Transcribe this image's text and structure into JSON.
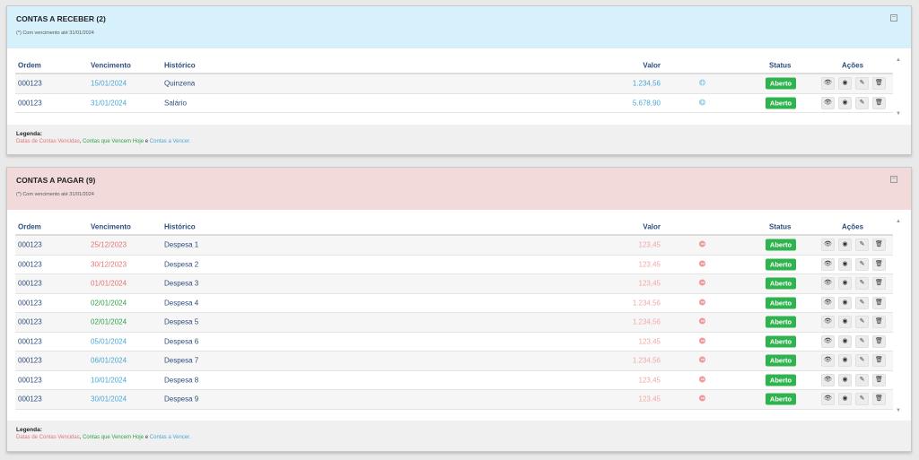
{
  "receber": {
    "title": "CONTAS A RECEBER (2)",
    "subtitle": "(*) Com vencimento até 31/01/2024",
    "collapse_icon": "minus-square-icon",
    "headers": {
      "ordem": "Ordem",
      "vencimento": "Vencimento",
      "historico": "Histórico",
      "valor": "Valor",
      "status": "Status",
      "acoes": "Ações"
    },
    "rows": [
      {
        "ordem": "000123",
        "vencimento": "15/01/2024",
        "historico": "Quinzena",
        "valor": "1.234,56",
        "status": "Aberto",
        "venc_color": "#4aa6d6",
        "valor_color": "#4aa6d6",
        "status_icon": "plus-circle-icon"
      },
      {
        "ordem": "000123",
        "vencimento": "31/01/2024",
        "historico": "Salário",
        "valor": "5.678,90",
        "status": "Aberto",
        "venc_color": "#4aa6d6",
        "valor_color": "#4aa6d6",
        "status_icon": "plus-circle-icon"
      }
    ],
    "legend": {
      "title": "Legenda:",
      "vencidas": "Datas de Contas Vencidas",
      "comma": ", ",
      "hoje": "Contas que Vencem Hoje",
      "e": " e ",
      "vencer": "Contas a Vencer",
      "dot": "."
    }
  },
  "pagar": {
    "title": "CONTAS A PAGAR (9)",
    "subtitle": "(*) Com vencimento até 31/01/2024",
    "collapse_icon": "minus-square-icon",
    "headers": {
      "ordem": "Ordem",
      "vencimento": "Vencimento",
      "historico": "Histórico",
      "valor": "Valor",
      "status": "Status",
      "acoes": "Ações"
    },
    "rows": [
      {
        "ordem": "000123",
        "vencimento": "25/12/2023",
        "historico": "Despesa 1",
        "valor": "123,45",
        "status": "Aberto",
        "venc_color": "#e57373",
        "valor_color": "#f0a8a8",
        "status_icon": "minus-circle-icon"
      },
      {
        "ordem": "000123",
        "vencimento": "30/12/2023",
        "historico": "Despesa 2",
        "valor": "123,45",
        "status": "Aberto",
        "venc_color": "#e57373",
        "valor_color": "#f0a8a8",
        "status_icon": "minus-circle-icon"
      },
      {
        "ordem": "000123",
        "vencimento": "01/01/2024",
        "historico": "Despesa 3",
        "valor": "123,45",
        "status": "Aberto",
        "venc_color": "#e57373",
        "valor_color": "#f0a8a8",
        "status_icon": "minus-circle-icon"
      },
      {
        "ordem": "000123",
        "vencimento": "02/01/2024",
        "historico": "Despesa 4",
        "valor": "1.234,56",
        "status": "Aberto",
        "venc_color": "#2fa14a",
        "valor_color": "#f0a8a8",
        "status_icon": "minus-circle-icon"
      },
      {
        "ordem": "000123",
        "vencimento": "02/01/2024",
        "historico": "Despesa 5",
        "valor": "1.234,56",
        "status": "Aberto",
        "venc_color": "#2fa14a",
        "valor_color": "#f0a8a8",
        "status_icon": "minus-circle-icon"
      },
      {
        "ordem": "000123",
        "vencimento": "05/01/2024",
        "historico": "Despesa 6",
        "valor": "123,45",
        "status": "Aberto",
        "venc_color": "#4aa6d6",
        "valor_color": "#f0a8a8",
        "status_icon": "minus-circle-icon"
      },
      {
        "ordem": "000123",
        "vencimento": "06/01/2024",
        "historico": "Despesa 7",
        "valor": "1.234,56",
        "status": "Aberto",
        "venc_color": "#4aa6d6",
        "valor_color": "#f0a8a8",
        "status_icon": "minus-circle-icon"
      },
      {
        "ordem": "000123",
        "vencimento": "10/01/2024",
        "historico": "Despesa 8",
        "valor": "123,45",
        "status": "Aberto",
        "venc_color": "#4aa6d6",
        "valor_color": "#f0a8a8",
        "status_icon": "minus-circle-icon"
      },
      {
        "ordem": "000123",
        "vencimento": "30/01/2024",
        "historico": "Despesa 9",
        "valor": "123,45",
        "status": "Aberto",
        "venc_color": "#4aa6d6",
        "valor_color": "#f0a8a8",
        "status_icon": "minus-circle-icon"
      }
    ],
    "legend": {
      "title": "Legenda:",
      "vencidas": "Datas de Contas Vencidas",
      "comma": ", ",
      "hoje": "Contas que Vencem Hoje",
      "e": " e ",
      "vencer": "Contas a Vencer",
      "dot": "."
    }
  },
  "actions": [
    {
      "icon": "eye-icon",
      "glyph": "👁"
    },
    {
      "icon": "target-icon",
      "glyph": "◉"
    },
    {
      "icon": "pencil-icon",
      "glyph": "✎"
    },
    {
      "icon": "trash-icon",
      "glyph": "🗑"
    }
  ],
  "scroll": {
    "up": "▲",
    "down": "▼"
  }
}
